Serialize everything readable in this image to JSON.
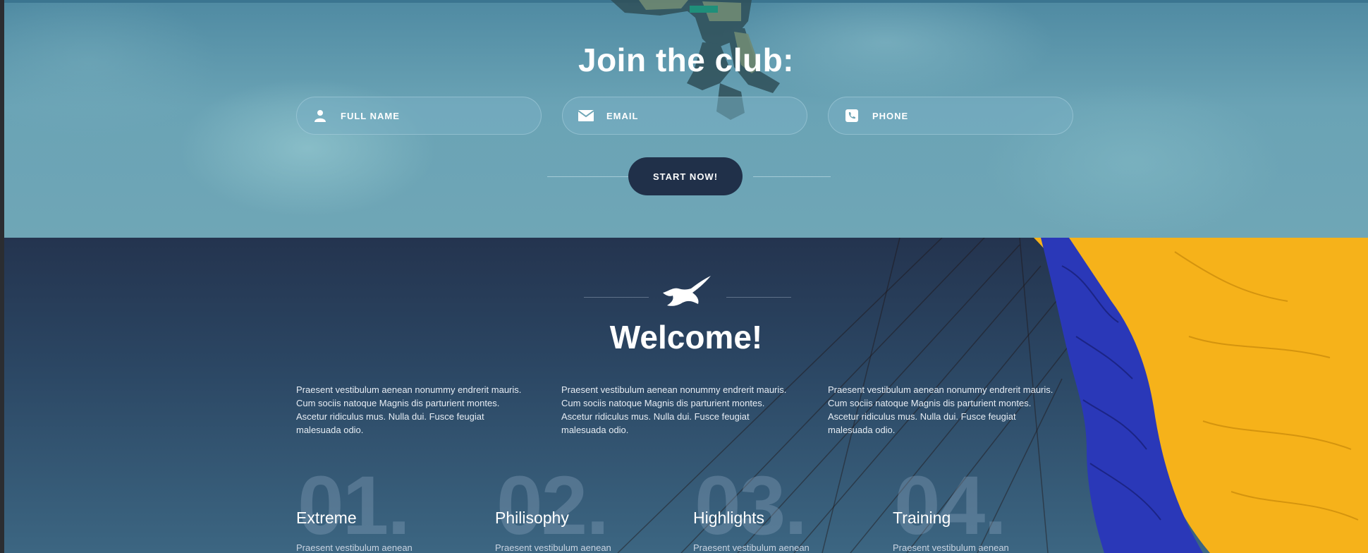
{
  "hero": {
    "title": "Join the club:",
    "fields": {
      "full_name": "FULL NAME",
      "email": "EMAIL",
      "phone": "PHONE"
    },
    "button_label": "START NOW!"
  },
  "welcome": {
    "title": "Welcome!",
    "columns": [
      {
        "lines": [
          "Praesent vestibulum aenean nonummy endrerit mauris.",
          "Cum sociis natoque Magnis dis parturient montes.",
          "Ascetur ridiculus mus. Nulla dui. Fusce feugiat",
          "malesuada odio."
        ]
      },
      {
        "lines": [
          "Praesent vestibulum aenean nonummy endrerit mauris.",
          "Cum sociis natoque Magnis dis parturient montes.",
          "Ascetur ridiculus mus. Nulla dui. Fusce feugiat",
          "malesuada odio."
        ]
      },
      {
        "lines": [
          "Praesent vestibulum aenean nonummy endrerit mauris.",
          "Cum sociis natoque Magnis dis parturient montes.",
          "Ascetur ridiculus mus. Nulla dui. Fusce feugiat",
          "malesuada odio."
        ]
      }
    ],
    "features": [
      {
        "number": "01.",
        "title": "Extreme",
        "desc": "Praesent vestibulum aenean"
      },
      {
        "number": "02.",
        "title": "Philisophy",
        "desc": "Praesent vestibulum aenean"
      },
      {
        "number": "03.",
        "title": "Highlights",
        "desc": "Praesent vestibulum aenean"
      },
      {
        "number": "04.",
        "title": "Training",
        "desc": "Praesent vestibulum aenean"
      }
    ]
  },
  "colors": {
    "hero_bg": "#6aa3b5",
    "button_bg": "#203049",
    "welcome_bg": "#2b4663",
    "canopy_yellow": "#f6b21a",
    "canopy_blue": "#2a38b8"
  },
  "icons": [
    "user-icon",
    "envelope-icon",
    "phone-icon",
    "eagle-icon"
  ]
}
